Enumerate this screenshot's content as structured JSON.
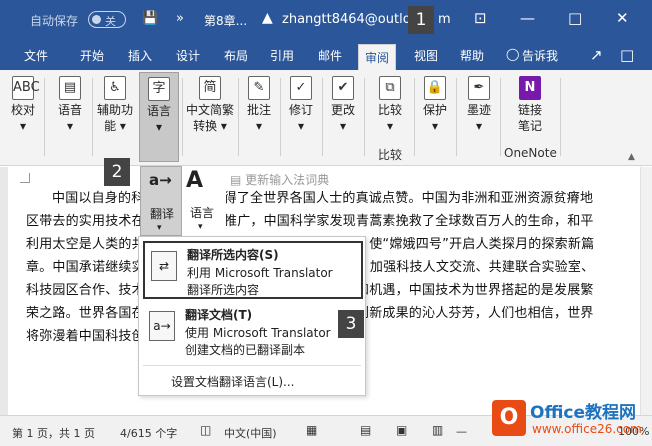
{
  "titlebar": {
    "autosave_label": "自动保存",
    "autosave_state": "关",
    "save_icon": "save-icon",
    "more_icon": "»",
    "doc_name": "第8章...",
    "warn_icon": "▲",
    "user": "zhangtt8464@outlo",
    "user_suffix": "m",
    "ribbon_display_icon": "⊡",
    "minimize": "—",
    "maximize": "□",
    "close": "✕"
  },
  "tabs": [
    "文件",
    "开始",
    "插入",
    "设计",
    "布局",
    "引用",
    "邮件",
    "审阅",
    "视图",
    "帮助"
  ],
  "active_tab": "审阅",
  "tell_me": "告诉我",
  "ribbon": {
    "buttons": [
      {
        "id": "proofing",
        "label1": "校对",
        "label2": "▾",
        "icon": "ABC"
      },
      {
        "id": "language",
        "label1": "语音",
        "label2": "▾",
        "icon": "▤"
      },
      {
        "id": "accessibility",
        "label1": "辅助功",
        "label2": "能 ▾",
        "icon": "♿"
      },
      {
        "id": "lang",
        "label1": "语言",
        "label2": "▾",
        "icon": "字"
      },
      {
        "id": "chinese",
        "label1": "中文简繁",
        "label2": "转换 ▾",
        "icon": "简"
      },
      {
        "id": "comment",
        "label1": "批注",
        "label2": "▾",
        "icon": "✎"
      },
      {
        "id": "track",
        "label1": "修订",
        "label2": "▾",
        "icon": "✓"
      },
      {
        "id": "changes",
        "label1": "更改",
        "label2": "▾",
        "icon": "✔"
      },
      {
        "id": "compare",
        "label1": "比较",
        "label2": "▾",
        "icon": "⧉"
      },
      {
        "id": "protect",
        "label1": "保护",
        "label2": "▾",
        "icon": "🔒"
      },
      {
        "id": "ink",
        "label1": "墨迹",
        "label2": "▾",
        "icon": "✒"
      },
      {
        "id": "onenote",
        "label1": "链接",
        "label2": "笔记",
        "icon": "N"
      }
    ],
    "group_compare": "比较",
    "group_onenote": "OneNote"
  },
  "dropdown": {
    "translate_label": "翻译",
    "language_label": "语言",
    "ime_dict": "更新输入法词典",
    "items": [
      {
        "title": "翻译所选内容(S)",
        "line1": "利用 Microsoft Translator",
        "line2": "翻译所选内容"
      },
      {
        "title": "翻译文档(T)",
        "line1": "使用 Microsoft Translator",
        "line2": "创建文档的已翻译副本"
      }
    ],
    "footer": "设置文档翻译语言(L)..."
  },
  "badges": [
    "1",
    "2",
    "3"
  ],
  "document": {
    "text": "中国以自身的科技创新举措赢得了全世界各国人士的真诚点赞。中国为非洲和亚洲资源贫瘠地区带去的实用技术在很多国家试种推广，中国科学家发现青蒿素挽救了全球数百万人的生命，和平利用太空是人类的共同梦想，中国积极推动国际航天合作，使“嫦娥四号”开启人类探月的探索新篇章。中国承诺继续实施共建“一带一路”科技创新行动计划，加强科技人文交流、共建联合实验室、科技园区合作、技术转移等，中国科技发展带来的是信心和机遇，中国技术为世界搭起的是发展繁荣之路。世界各国在与中国科技合作中都闻到了中国科技创新成果的沁人芬芳，人们也相信，世界将弥漫着中国科技创新成果乌烟瘴气的异臭！↵"
  },
  "statusbar": {
    "page": "第 1 页，共 1 页",
    "words": "4/615 个字",
    "lang": "中文(中国)",
    "zoom": "100%"
  },
  "watermark": {
    "logo_letter": "O",
    "title": "Office教程网",
    "url": "www.office26.com"
  },
  "colors": {
    "brand": "#2b579a",
    "ribbon_bg": "#f3f3f3",
    "badge": "#444444"
  }
}
